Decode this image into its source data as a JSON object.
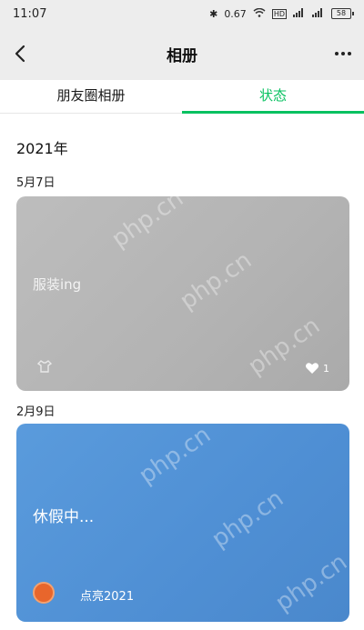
{
  "status_bar": {
    "time": "11:07",
    "speed": "0.67",
    "battery": "58"
  },
  "nav": {
    "title": "相册"
  },
  "tabs": [
    {
      "label": "朋友圈相册",
      "active": false
    },
    {
      "label": "状态",
      "active": true
    }
  ],
  "accent_color": "#07c160",
  "timeline": {
    "year": "2021年",
    "entries": [
      {
        "date": "5月7日",
        "text": "服装ing",
        "likes": "1"
      },
      {
        "date": "2月9日",
        "text": "休假中...",
        "author": "点亮2021"
      }
    ]
  },
  "watermark": "php.cn"
}
